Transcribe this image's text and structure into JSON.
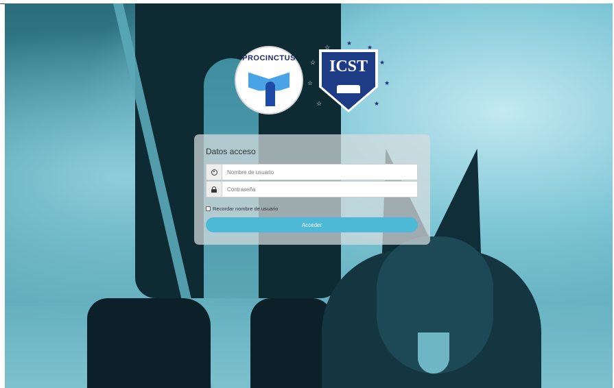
{
  "colors": {
    "accent_button": "#4eb9d6",
    "panel": "rgba(215,220,222,0.72)",
    "photo_tint": "#3f8ea0",
    "icst_shield": "#1d3c85",
    "procinctus_text": "#1c2e6e"
  },
  "logos": {
    "procinctus": {
      "text": "PROCINCTUS",
      "icon": "eagle-icon"
    },
    "icst": {
      "text": "ICST",
      "icon": "book-icon"
    }
  },
  "login": {
    "title": "Datos acceso",
    "username": {
      "placeholder": "Nombre de usuario",
      "value": "",
      "icon": "user-circle-icon"
    },
    "password": {
      "placeholder": "Contraseña",
      "value": "",
      "icon": "lock-icon"
    },
    "remember_label": "Recordar nombre de usuario",
    "remember_checked": false,
    "submit_label": "Acceder"
  }
}
